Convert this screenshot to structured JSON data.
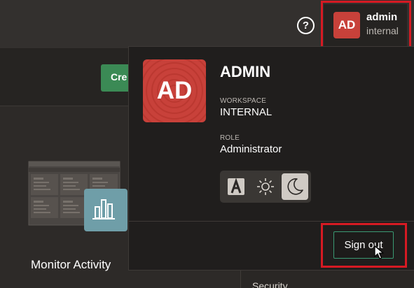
{
  "header": {
    "help_icon": "question-circle-icon",
    "help_glyph": "?",
    "user": {
      "initials": "AD",
      "name": "admin",
      "workspace": "internal"
    }
  },
  "background": {
    "create_button_label": "Cre",
    "card": {
      "title": "Monitor Activity",
      "icon": "dashboard-chart-icon"
    },
    "side_item_label": "Security"
  },
  "user_panel": {
    "initials": "AD",
    "username": "ADMIN",
    "workspace_label": "WORKSPACE",
    "workspace_value": "INTERNAL",
    "role_label": "ROLE",
    "role_value": "Administrator",
    "theme_options": [
      {
        "icon": "accessible-theme-icon",
        "active": false
      },
      {
        "icon": "sun-light-theme-icon",
        "active": false
      },
      {
        "icon": "moon-dark-theme-icon",
        "active": true
      }
    ],
    "sign_out_label": "Sign out"
  },
  "colors": {
    "avatar": "#c8413a",
    "create_button": "#3b8a55",
    "sign_out_border": "#3a9a73",
    "highlight": "#d61a23",
    "panel_bg": "#201e1d"
  }
}
